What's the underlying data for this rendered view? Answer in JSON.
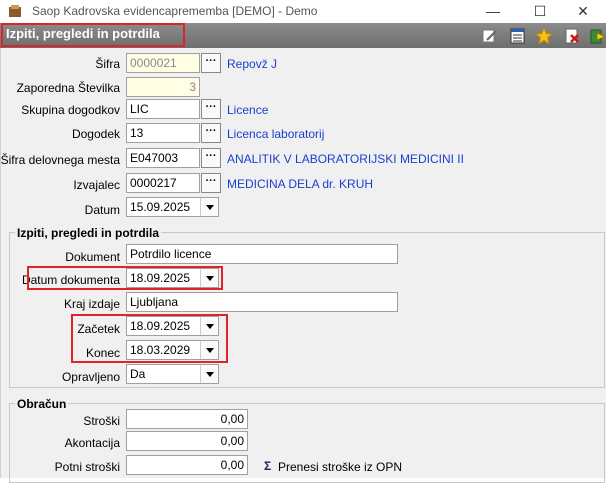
{
  "window": {
    "title": "Saop Kadrovska evidencaprememba [DEMO] - Demo",
    "minimize": "—",
    "maximize": "☐",
    "close": "✕"
  },
  "header": {
    "title": "Izpiti, pregledi in potrdila"
  },
  "toolbar": {
    "icons": [
      "edit-icon",
      "list-icon",
      "favorite-star-icon",
      "delete-icon",
      "exit-icon"
    ]
  },
  "form": {
    "sifra": {
      "label": "Šifra",
      "value": "0000021",
      "desc": "Repovž J"
    },
    "zaporedna": {
      "label": "Zaporedna Številka",
      "value": "3"
    },
    "skupina": {
      "label": "Skupina dogodkov",
      "value": "LIC",
      "desc": "Licence"
    },
    "dogodek": {
      "label": "Dogodek",
      "value": "13",
      "desc": "Licenca laboratorij"
    },
    "delovno_mesto": {
      "label": "Šifra delovnega mesta",
      "value": "E047003",
      "desc": "ANALITIK V LABORATORIJSKI MEDICINI II"
    },
    "izvajalec": {
      "label": "Izvajalec",
      "value": "0000217",
      "desc": "MEDICINA DELA dr. KRUH"
    },
    "datum": {
      "label": "Datum",
      "value": "15.09.2025"
    }
  },
  "izpiti": {
    "title": "Izpiti, pregledi in potrdila",
    "dokument": {
      "label": "Dokument",
      "value": "Potrdilo licence"
    },
    "datum_dokumenta": {
      "label": "Datum dokumenta",
      "value": "18.09.2025"
    },
    "kraj_izdaje": {
      "label": "Kraj izdaje",
      "value": "Ljubljana"
    },
    "zacetek": {
      "label": "Začetek",
      "value": "18.09.2025"
    },
    "konec": {
      "label": "Konec",
      "value": "18.03.2029"
    },
    "opravljeno": {
      "label": "Opravljeno",
      "value": "Da"
    }
  },
  "obracun": {
    "title": "Obračun",
    "stroski": {
      "label": "Stroški",
      "value": "0,00"
    },
    "akontacija": {
      "label": "Akontacija",
      "value": "0,00"
    },
    "potni_stroski": {
      "label": "Potni stroški",
      "value": "0,00"
    },
    "prenesi": {
      "symbol": "Σ",
      "label": "Prenesi stroške iz OPN"
    }
  },
  "colors": {
    "highlight": "#e0232b",
    "link": "#1a3fcf",
    "header": "#7a7a7a"
  }
}
